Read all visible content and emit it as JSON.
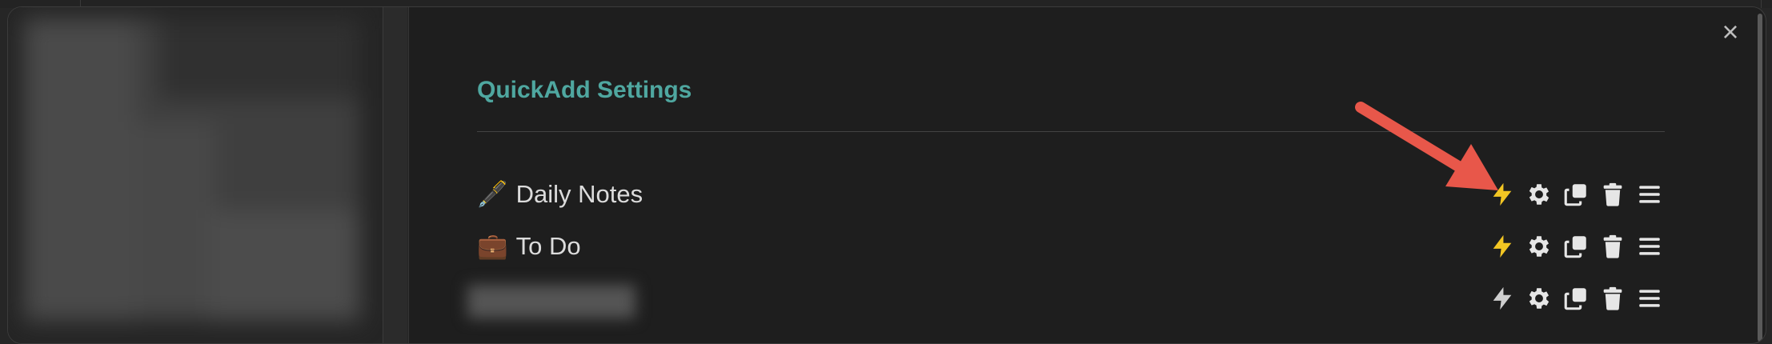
{
  "modal": {
    "close_label": "×"
  },
  "settings": {
    "title": "QuickAdd Settings"
  },
  "choices": [
    {
      "emoji": "🖋️",
      "name": "Daily Notes",
      "command_enabled": true,
      "blurred": false
    },
    {
      "emoji": "💼",
      "name": "To Do",
      "command_enabled": true,
      "blurred": false
    },
    {
      "emoji": "",
      "name": "",
      "command_enabled": false,
      "blurred": true
    }
  ],
  "icons": {
    "command": "lightning-icon",
    "configure": "gear-icon",
    "duplicate": "copy-icon",
    "delete": "trash-icon",
    "drag": "menu-icon"
  },
  "colors": {
    "accent": "#4fa7a0",
    "command_enabled": "#f3c623",
    "command_disabled": "#cfcfcf",
    "annotation_arrow": "#e8574a"
  }
}
